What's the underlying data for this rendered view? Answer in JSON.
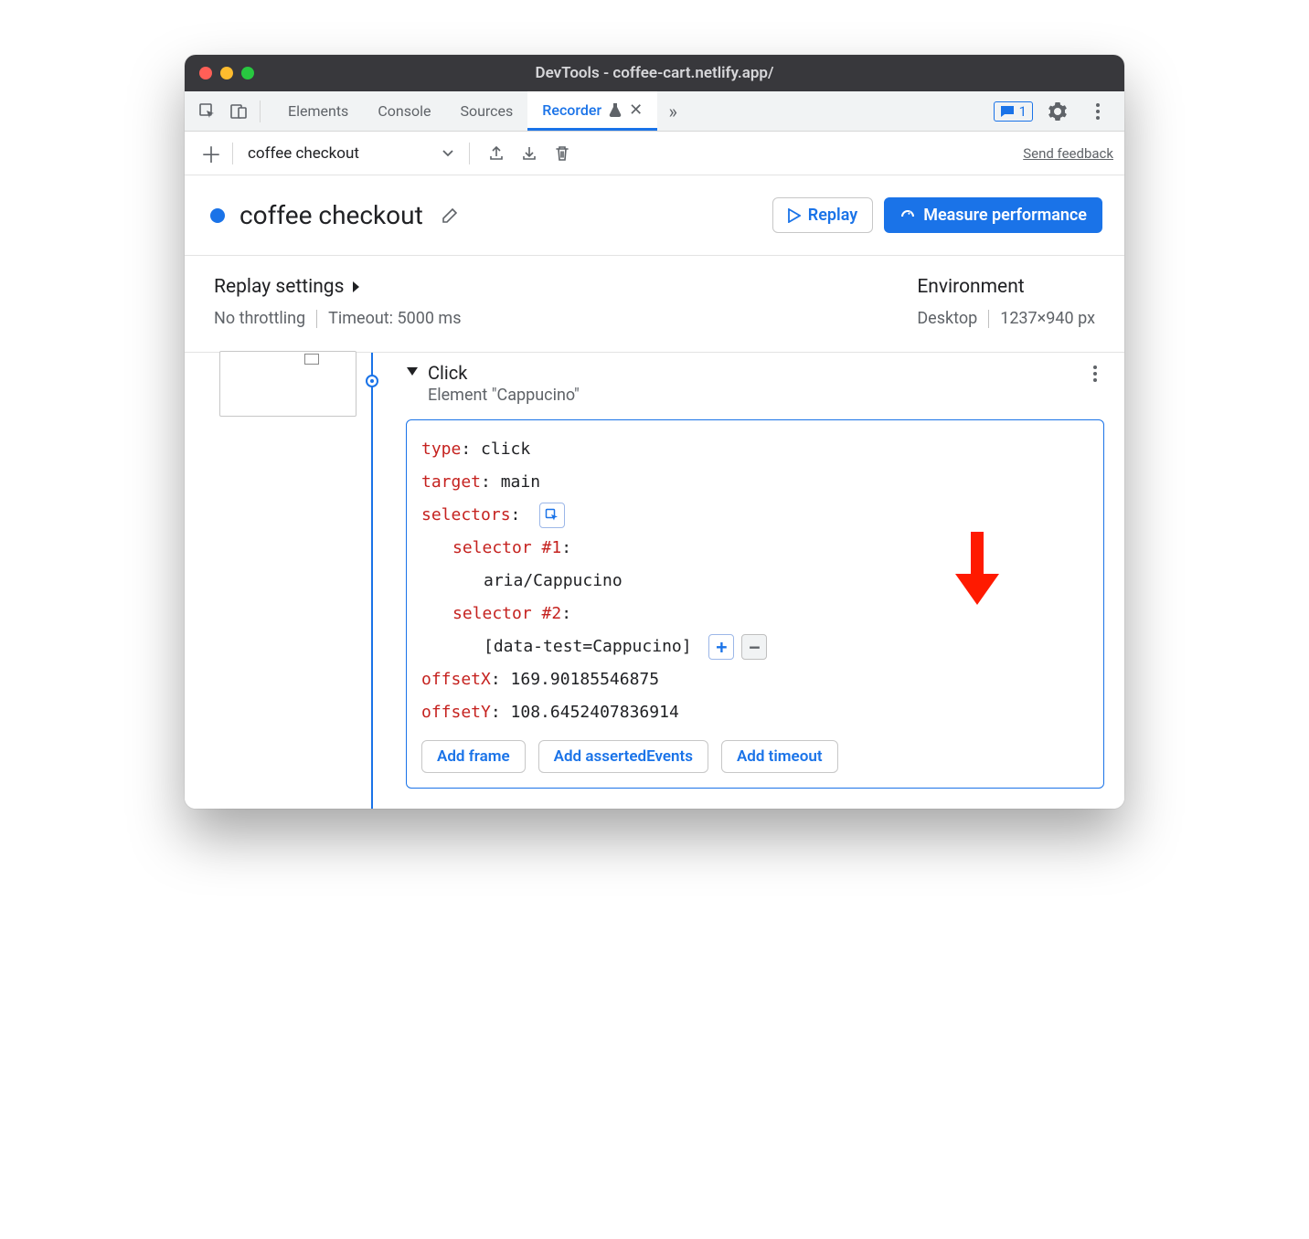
{
  "titlebar": {
    "title": "DevTools - coffee-cart.netlify.app/"
  },
  "tabs": {
    "items": [
      "Elements",
      "Console",
      "Sources"
    ],
    "active": "Recorder",
    "issues_count": "1"
  },
  "toolbar": {
    "recording_name": "coffee checkout",
    "send_feedback": "Send feedback"
  },
  "header": {
    "title": "coffee checkout",
    "replay": "Replay",
    "measure": "Measure performance"
  },
  "settings": {
    "replay_heading": "Replay settings",
    "throttling": "No throttling",
    "timeout": "Timeout: 5000 ms",
    "env_heading": "Environment",
    "device": "Desktop",
    "dimensions": "1237×940 px"
  },
  "step": {
    "name": "Click",
    "subtitle": "Element \"Cappucino\"",
    "props": {
      "type_key": "type",
      "type_val": "click",
      "target_key": "target",
      "target_val": "main",
      "selectors_key": "selectors",
      "sel1_key": "selector #1",
      "sel1_val": "aria/Cappucino",
      "sel2_key": "selector #2",
      "sel2_val": "[data-test=Cappucino]",
      "offx_key": "offsetX",
      "offx_val": "169.90185546875",
      "offy_key": "offsetY",
      "offy_val": "108.6452407836914"
    },
    "add_frame": "Add frame",
    "add_asserted": "Add assertedEvents",
    "add_timeout": "Add timeout"
  }
}
